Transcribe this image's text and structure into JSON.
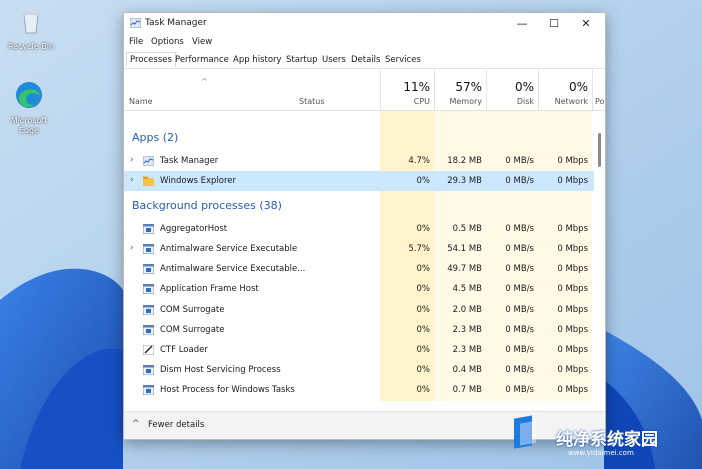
{
  "desktop": {
    "icons": [
      {
        "label": "Recycle Bin"
      },
      {
        "label": "Microsoft Edge"
      }
    ]
  },
  "window": {
    "title": "Task Manager",
    "controls": {
      "minimize": "—",
      "maximize": "☐",
      "close": "✕"
    }
  },
  "menu": [
    "File",
    "Options",
    "View"
  ],
  "tabs": [
    "Processes",
    "Performance",
    "App history",
    "Startup",
    "Users",
    "Details",
    "Services"
  ],
  "active_tab": "Processes",
  "header": {
    "name": "Name",
    "status": "Status",
    "cpu": {
      "pct": "11%",
      "label": "CPU"
    },
    "memory": {
      "pct": "57%",
      "label": "Memory"
    },
    "disk": {
      "pct": "0%",
      "label": "Disk"
    },
    "network": {
      "pct": "0%",
      "label": "Network"
    },
    "power": "Po",
    "sort_caret": "^"
  },
  "groups": {
    "apps": "Apps (2)",
    "background": "Background processes (38)"
  },
  "rows": [
    {
      "name": "Task Manager",
      "cpu": "4.7%",
      "memory": "18.2 MB",
      "disk": "0 MB/s",
      "network": "0 Mbps",
      "expand": "›"
    },
    {
      "name": "Windows Explorer",
      "cpu": "0%",
      "memory": "29.3 MB",
      "disk": "0 MB/s",
      "network": "0 Mbps",
      "expand": "›"
    },
    {
      "name": "AggregatorHost",
      "cpu": "0%",
      "memory": "0.5 MB",
      "disk": "0 MB/s",
      "network": "0 Mbps",
      "expand": ""
    },
    {
      "name": "Antimalware Service Executable",
      "cpu": "5.7%",
      "memory": "54.1 MB",
      "disk": "0 MB/s",
      "network": "0 Mbps",
      "expand": "›"
    },
    {
      "name": "Antimalware Service Executable...",
      "cpu": "0%",
      "memory": "49.7 MB",
      "disk": "0 MB/s",
      "network": "0 Mbps",
      "expand": ""
    },
    {
      "name": "Application Frame Host",
      "cpu": "0%",
      "memory": "4.5 MB",
      "disk": "0 MB/s",
      "network": "0 Mbps",
      "expand": ""
    },
    {
      "name": "COM Surrogate",
      "cpu": "0%",
      "memory": "2.0 MB",
      "disk": "0 MB/s",
      "network": "0 Mbps",
      "expand": ""
    },
    {
      "name": "COM Surrogate",
      "cpu": "0%",
      "memory": "2.3 MB",
      "disk": "0 MB/s",
      "network": "0 Mbps",
      "expand": ""
    },
    {
      "name": "CTF Loader",
      "cpu": "0%",
      "memory": "2.3 MB",
      "disk": "0 MB/s",
      "network": "0 Mbps",
      "expand": ""
    },
    {
      "name": "Dism Host Servicing Process",
      "cpu": "0%",
      "memory": "0.4 MB",
      "disk": "0 MB/s",
      "network": "0 Mbps",
      "expand": ""
    },
    {
      "name": "Host Process for Windows Tasks",
      "cpu": "0%",
      "memory": "0.7 MB",
      "disk": "0 MB/s",
      "network": "0 Mbps",
      "expand": ""
    }
  ],
  "footer": {
    "chevron": "^",
    "label": "Fewer details"
  },
  "watermark": {
    "text_cn": "纯净系统家园",
    "url": "www.yidaimei.com"
  },
  "colors": {
    "accent": "#2a5ea8",
    "cpu_tint": "#fff4cc",
    "metric_tint": "#fff9e6",
    "selected": "#cce8ff"
  }
}
